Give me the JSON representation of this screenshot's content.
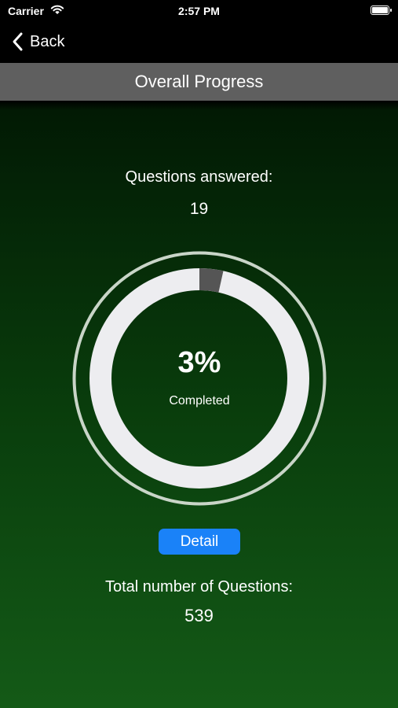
{
  "status_bar": {
    "carrier": "Carrier",
    "time": "2:57 PM"
  },
  "nav": {
    "back_label": "Back",
    "title": "Overall Progress"
  },
  "progress": {
    "answered_label": "Questions answered:",
    "answered_value": "19",
    "percent_text": "3%",
    "completed_label": "Completed",
    "completed_fraction": 0.035,
    "detail_label": "Detail",
    "total_label": "Total number of Questions:",
    "total_value": "539"
  },
  "colors": {
    "ring_track": "#ededf0",
    "ring_progress": "#555555",
    "outer_ring": "#c9d5c8",
    "title_bar": "#5f5f5f",
    "button": "#1a82f8"
  }
}
